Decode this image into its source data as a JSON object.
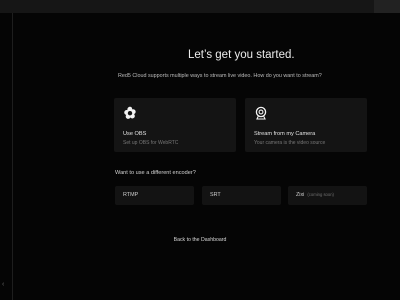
{
  "page": {
    "title": "Let’s get you started.",
    "subtitle": "Red5 Cloud supports multiple ways to stream live video. How do you want to stream?"
  },
  "options": [
    {
      "label": "Use OBS",
      "description": "Set up OBS for WebRTC",
      "icon": "obs-icon"
    },
    {
      "label": "Stream from my Camera",
      "description": "Your camera is the video source",
      "icon": "webcam-icon"
    }
  ],
  "encoders": {
    "heading": "Want to use a different encoder?",
    "items": [
      {
        "label": "RTMP",
        "note": ""
      },
      {
        "label": "SRT",
        "note": ""
      },
      {
        "label": "Zixi",
        "note": "(coming soon)"
      }
    ]
  },
  "footer": {
    "back_label": "Back to the Dashboard"
  },
  "sidebar": {
    "collapse_icon": "chevron-icon"
  }
}
